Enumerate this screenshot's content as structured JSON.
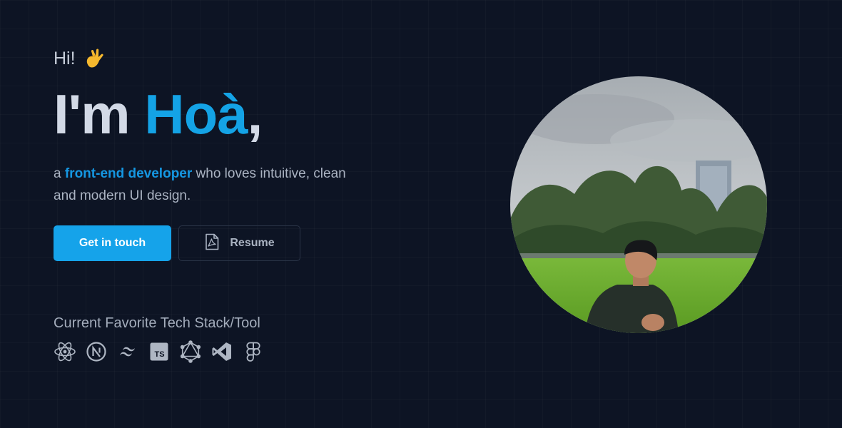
{
  "hero": {
    "greeting": "Hi!",
    "greeting_emoji": "call-me-hand-icon",
    "headline_prefix": "I'm",
    "name": "Hoà",
    "headline_suffix": ",",
    "tagline_prefix": "a",
    "role": "front-end developer",
    "tagline_rest": "who loves intuitive, clean and modern UI design."
  },
  "actions": {
    "primary_label": "Get in touch",
    "secondary_label": "Resume",
    "secondary_icon": "pdf-file-icon"
  },
  "tech_stack": {
    "title": "Current Favorite Tech Stack/Tool",
    "icons": [
      "react-icon",
      "nextjs-icon",
      "tailwind-icon",
      "typescript-icon",
      "graphql-icon",
      "vscode-icon",
      "figma-icon"
    ]
  },
  "portrait": {
    "icon": "profile-photo"
  },
  "colors": {
    "background": "#0d1424",
    "accent": "#15a3ea",
    "heading": "#d2d9e6",
    "muted": "#aab3c2"
  }
}
